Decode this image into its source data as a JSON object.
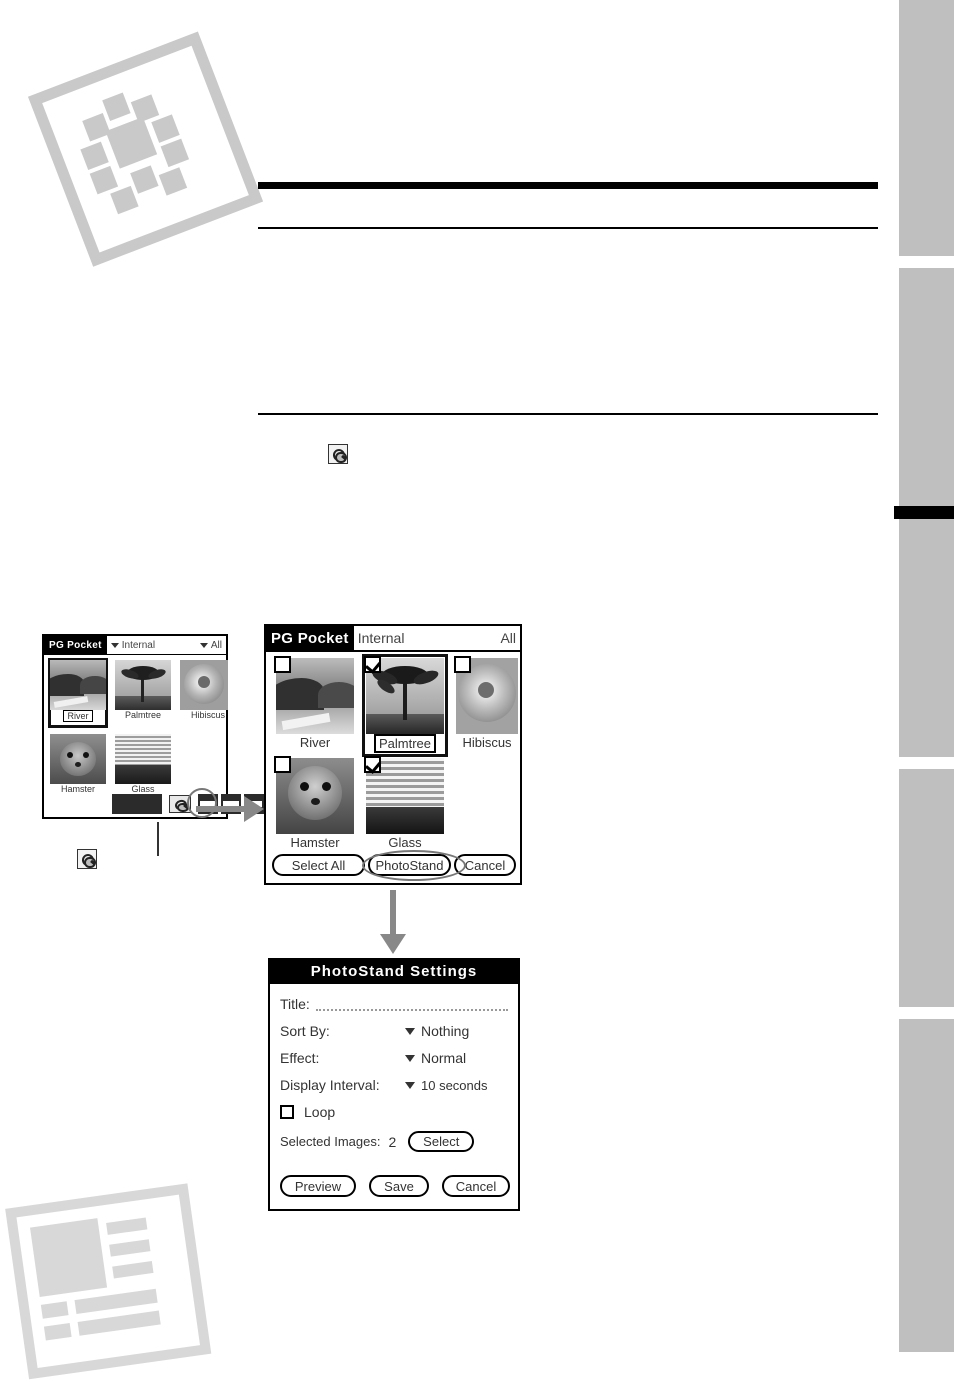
{
  "page": {
    "background": "#ffffff",
    "accent_gray": "#bfbfbf",
    "deco_top_name": "rotated-diamond-ornament",
    "deco_bottom_name": "rotated-page-layout-ornament"
  },
  "side_tabs": [
    {
      "label": ""
    },
    {
      "label": ""
    },
    {
      "label": ""
    },
    {
      "label": ""
    },
    {
      "label": ""
    }
  ],
  "inline_icon": {
    "name": "photostand-icon",
    "alt": "PhotoStand"
  },
  "small_device": {
    "title": "PG Pocket",
    "category": "Internal",
    "filter": "All",
    "caret_icon": "chevron-down-icon",
    "items": [
      {
        "label": "River",
        "selected": true
      },
      {
        "label": "Palmtree",
        "selected": false
      },
      {
        "label": "Hibiscus",
        "selected": false
      },
      {
        "label": "Hamster",
        "selected": false
      },
      {
        "label": "Glass",
        "selected": false
      }
    ],
    "toolbar": {
      "grid_view": "grid-view-icon",
      "list_view": "list-view-icon",
      "photostand": "photostand-icon",
      "extra_1": "beam-icon",
      "extra_2": "details-icon",
      "extra_3": "menu-icon"
    }
  },
  "large_device": {
    "title": "PG Pocket",
    "category": "Internal",
    "filter": "All",
    "items": [
      {
        "label": "River",
        "checked": false,
        "highlighted": false
      },
      {
        "label": "Palmtree",
        "checked": true,
        "highlighted": true
      },
      {
        "label": "Hibiscus",
        "checked": false,
        "highlighted": false
      },
      {
        "label": "Hamster",
        "checked": false,
        "highlighted": false
      },
      {
        "label": "Glass",
        "checked": true,
        "highlighted": false
      }
    ],
    "buttons": {
      "select_all": "Select All",
      "photostand": "PhotoStand",
      "cancel": "Cancel"
    }
  },
  "settings_dialog": {
    "title": "PhotoStand Settings",
    "fields": {
      "title_label": "Title:",
      "title_value": "",
      "sort_by_label": "Sort By:",
      "sort_by_value": "Nothing",
      "effect_label": "Effect:",
      "effect_value": "Normal",
      "display_interval_label": "Display Interval:",
      "display_interval_value": "10 seconds",
      "loop_label": "Loop",
      "loop_checked": false,
      "selected_images_label": "Selected Images:",
      "selected_images_value": "2",
      "select_button": "Select"
    },
    "buttons": {
      "preview": "Preview",
      "save": "Save",
      "cancel": "Cancel"
    },
    "caret_icon": "triangle-down-icon"
  }
}
